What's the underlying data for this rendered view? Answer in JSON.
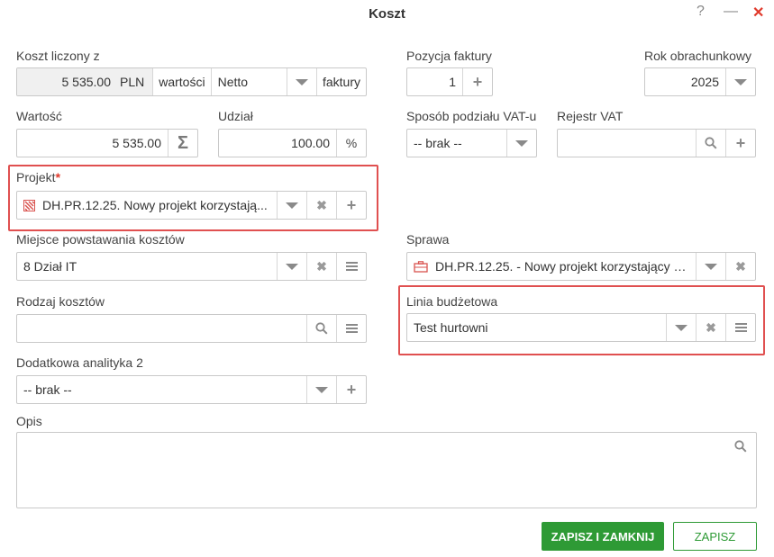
{
  "window": {
    "title": "Koszt",
    "help": "?",
    "minimize": "—",
    "close": "✕"
  },
  "cost_from": {
    "label": "Koszt liczony z",
    "amount": "5 535.00",
    "currency": "PLN",
    "of_label": "wartości",
    "net_value": "Netto",
    "invoice_label": "faktury"
  },
  "invoice_position": {
    "label": "Pozycja faktury",
    "value": "1"
  },
  "fiscal_year": {
    "label": "Rok obrachunkowy",
    "value": "2025"
  },
  "value": {
    "label": "Wartość",
    "amount": "5 535.00"
  },
  "share": {
    "label": "Udział",
    "amount": "100.00",
    "unit": "%"
  },
  "vat_split": {
    "label": "Sposób podziału VAT-u",
    "value": "-- brak --"
  },
  "vat_register": {
    "label": "Rejestr VAT",
    "value": ""
  },
  "project": {
    "label": "Projekt",
    "required_mark": "*",
    "value": "DH.PR.12.25. Nowy projekt korzystają..."
  },
  "cost_center": {
    "label": "Miejsce powstawania kosztów",
    "value": "8 Dział IT"
  },
  "case": {
    "label": "Sprawa",
    "value": "DH.PR.12.25. - Nowy projekt korzystający z..."
  },
  "cost_type": {
    "label": "Rodzaj kosztów",
    "value": ""
  },
  "budget_line": {
    "label": "Linia budżetowa",
    "value": "Test hurtowni"
  },
  "extra_analytics": {
    "label": "Dodatkowa analityka 2",
    "value": "-- brak --"
  },
  "description": {
    "label": "Opis",
    "value": ""
  },
  "buttons": {
    "save_close": "ZAPISZ I ZAMKNIJ",
    "save": "ZAPISZ"
  },
  "colors": {
    "accent_green": "#2e9a35",
    "highlight_red": "#e05050",
    "project_icon": "#d9534f"
  }
}
